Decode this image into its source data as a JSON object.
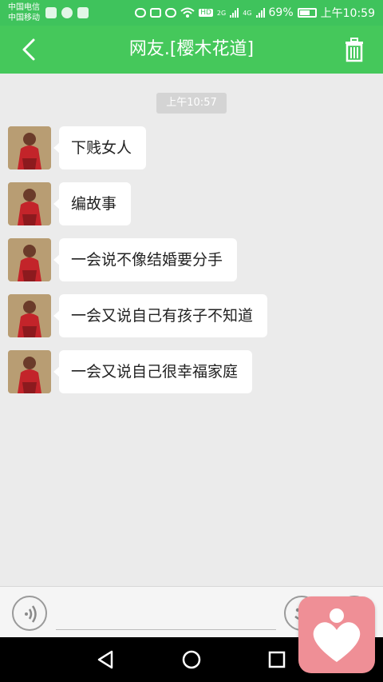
{
  "status_bar": {
    "carrier1": "中国电信",
    "carrier2": "中国移动",
    "hd_badge": "HD",
    "net1": "2G",
    "net2": "4G",
    "battery": "69%",
    "time": "上午10:59"
  },
  "header": {
    "title": "网友.[樱木花道]",
    "back_icon": "chevron-left-icon",
    "trash_icon": "trash-icon"
  },
  "chat": {
    "timestamp": "上午10:57",
    "messages": [
      {
        "text": "下贱女人"
      },
      {
        "text": "编故事"
      },
      {
        "text": "一会说不像结婚要分手"
      },
      {
        "text": "一会又说自己有孩子不知道"
      },
      {
        "text": "一会又说自己很幸福家庭"
      }
    ]
  },
  "input_bar": {
    "voice_icon": "voice-icon",
    "emoji_icon": "emoji-icon",
    "more_icon": "plus-icon",
    "input_value": ""
  },
  "nav_bar": {
    "back_icon": "triangle-back-icon",
    "home_icon": "circle-home-icon",
    "recents_icon": "square-recents-icon"
  },
  "overlay": {
    "icon": "heart-person-icon"
  },
  "colors": {
    "accent": "#45c85b",
    "status": "#3fc35c",
    "background": "#ebebeb",
    "bubble": "#ffffff",
    "overlay": "#ef8f96"
  }
}
